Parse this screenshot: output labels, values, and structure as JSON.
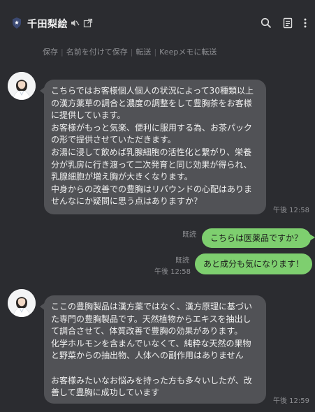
{
  "header": {
    "title": "千田梨絵",
    "icons": [
      "shield-star-icon",
      "mute-icon",
      "external-window-icon",
      "search-icon",
      "notes-icon",
      "more-vertical-icon"
    ]
  },
  "toolbar": {
    "save": "保存",
    "save_as": "名前を付けて保存",
    "forward": "転送",
    "keep_forward": "Keepメモに転送"
  },
  "messages": [
    {
      "type": "incoming",
      "text": "こちらではお客様個人個人の状況によって30種類以上の漢方薬草の調合と濃度の調整をして豊胸茶をお客様に提供しています。\nお客様がもっと気楽、便利に服用する為、お茶パックの形で提供させていただきます。\nお湯に浸して飲めば乳腺細胞の活性化と繋がり、栄養分が乳房に行き渡って二次発育と同じ効果が得られ、乳腺細胞が増え胸が大きくなります。\n中身からの改善での豊胸はリバウンドの心配はありませんなにか疑問に思う点はありますか？",
      "time": "午後 12:58"
    },
    {
      "type": "outgoing",
      "read": "既読",
      "text": "こちらは医薬品ですか？"
    },
    {
      "type": "outgoing",
      "read": "既読",
      "time": "午後 12:58",
      "text": "あと成分も気になります！"
    },
    {
      "type": "incoming",
      "text": "ここの豊胸製品は漢方薬ではなく、漢方原理に基づいた専門の豊胸製品です。天然植物からエキスを抽出して調合させて、体質改善で豊胸の効果があります。\n化学ホルモンを含まんでいなくて、純粋な天然の果物と野菜からの抽出物、人体への副作用はありません\n\nお客様みたいなお悩みを持った方も多々いしたが、改善して豊胸に成功しています",
      "time": "午後 12:59"
    }
  ],
  "colors": {
    "background": "#2b2c30",
    "incoming_bubble": "#515256",
    "outgoing_bubble": "#7ecf6f",
    "meta_text": "#8e8f93"
  }
}
